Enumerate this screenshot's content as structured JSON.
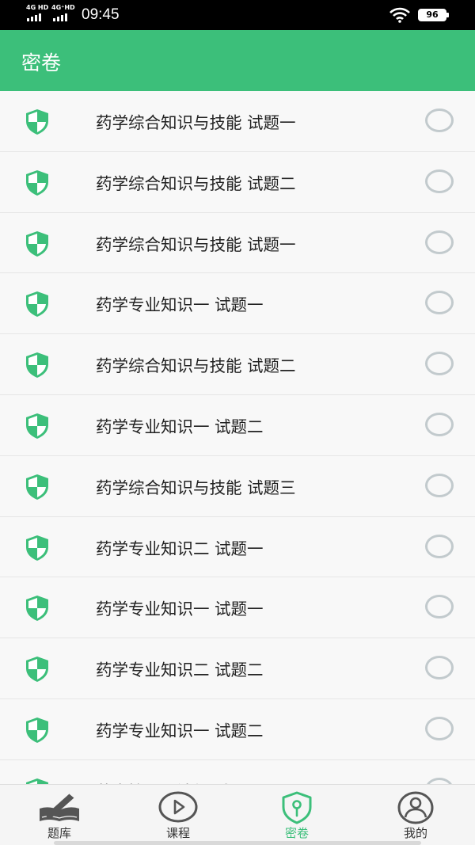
{
  "status": {
    "sim1": "4G HD",
    "sim2": "4G⁺HD",
    "time": "09:45",
    "battery": "96"
  },
  "header": {
    "title": "密卷"
  },
  "colors": {
    "accent": "#3cbf7a",
    "radio_border": "#c2cacd"
  },
  "papers": [
    {
      "title": "药学综合知识与技能 试题一",
      "icon": "shield-icon",
      "selected": false
    },
    {
      "title": "药学综合知识与技能 试题二",
      "icon": "shield-icon",
      "selected": false
    },
    {
      "title": "药学综合知识与技能 试题一",
      "icon": "shield-icon",
      "selected": false
    },
    {
      "title": "药学专业知识一 试题一",
      "icon": "shield-icon",
      "selected": false
    },
    {
      "title": "药学综合知识与技能 试题二",
      "icon": "shield-icon",
      "selected": false
    },
    {
      "title": "药学专业知识一 试题二",
      "icon": "shield-icon",
      "selected": false
    },
    {
      "title": "药学综合知识与技能 试题三",
      "icon": "shield-icon",
      "selected": false
    },
    {
      "title": "药学专业知识二 试题一",
      "icon": "shield-icon",
      "selected": false
    },
    {
      "title": "药学专业知识一 试题一",
      "icon": "shield-icon",
      "selected": false
    },
    {
      "title": "药学专业知识二 试题二",
      "icon": "shield-icon",
      "selected": false
    },
    {
      "title": "药学专业知识一 试题二",
      "icon": "shield-icon",
      "selected": false
    },
    {
      "title": "药事管理与法规 试题一",
      "icon": "shield-icon",
      "selected": false
    }
  ],
  "nav": [
    {
      "label": "题库",
      "icon": "book-pen-icon",
      "active": false
    },
    {
      "label": "课程",
      "icon": "play-circle-icon",
      "active": false
    },
    {
      "label": "密卷",
      "icon": "shield-lock-icon",
      "active": true
    },
    {
      "label": "我的",
      "icon": "user-icon",
      "active": false
    }
  ]
}
